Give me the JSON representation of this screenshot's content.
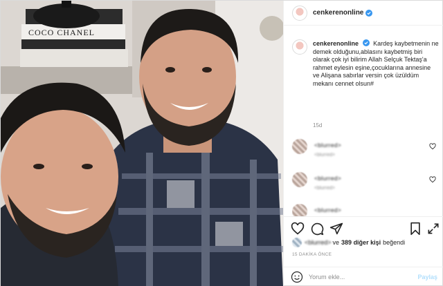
{
  "post": {
    "username": "cenkerenonline",
    "verified": true
  },
  "photo": {
    "box_brand_text": "COCO CHANEL"
  },
  "caption": {
    "username": "cenkerenonline",
    "text": "Kardeş kaybetmenin ne demek olduğunu,ablasını kaybetmiş biri olarak çok iyi bilirim Allah Selçuk Tektaş'a rahmet eylesin eşine,çocuklarına annesine ve Alişana sabırlar versin çok üzüldüm mekanı cennet olsun#",
    "age": "15d"
  },
  "comments": [
    {
      "name": "<blurred>",
      "text": "",
      "meta": "<blurred>"
    },
    {
      "name": "<blurred>",
      "text": "",
      "meta": "<blurred>"
    },
    {
      "name": "<blurred>",
      "text": "",
      "meta": ""
    }
  ],
  "likes": {
    "liker": "<blurred>",
    "text_ve": "ve",
    "count_text": "389 diğer kişi",
    "text_begendi": "beğendi"
  },
  "timestamp": "15 DAKİKA ÖNCE",
  "add_comment": {
    "placeholder": "Yorum ekle...",
    "share_label": "Paylaş"
  },
  "colors": {
    "verified_blue": "#3897f0",
    "muted": "#8e8e8e",
    "share_disabled": "#b2dffc"
  }
}
